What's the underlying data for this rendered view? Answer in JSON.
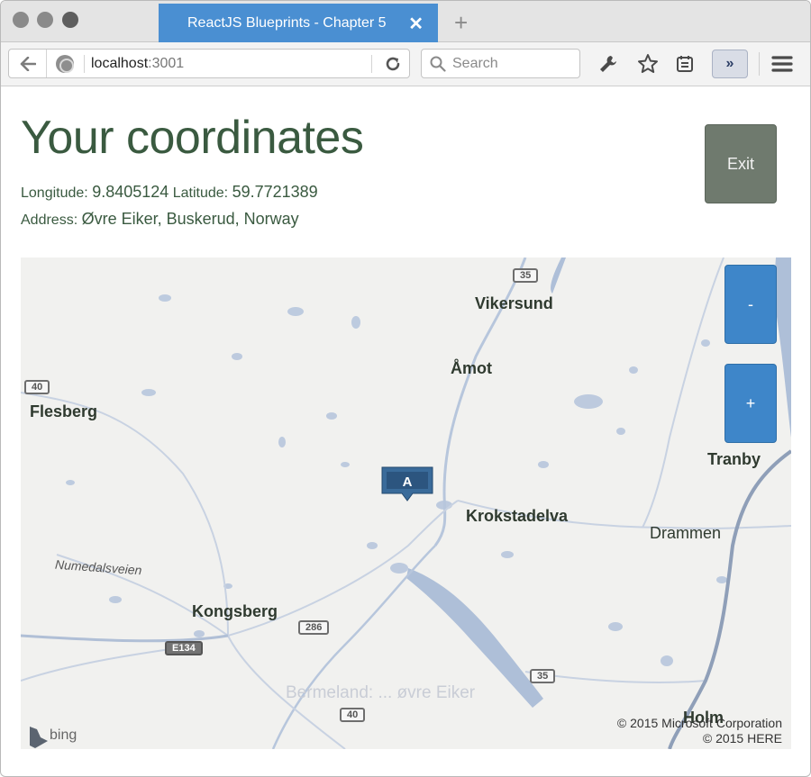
{
  "browser": {
    "tab_title": "ReactJS Blueprints - Chapter 5",
    "tab_close": "✕",
    "new_tab": "+",
    "url_host": "localhost",
    "url_port": ":3001",
    "search_placeholder": "Search",
    "overflow": "»",
    "icons": [
      "back-arrow-icon",
      "globe-icon",
      "reload-icon",
      "search-icon",
      "wrench-icon",
      "star-icon",
      "reading-list-icon",
      "menu-icon"
    ]
  },
  "page": {
    "title": "Your coordinates",
    "longitude_label": "Longitude:",
    "longitude_value": "9.8405124",
    "latitude_label": "Latitude:",
    "latitude_value": "59.7721389",
    "address_label": "Address:",
    "address_value": "Øvre Eiker, Buskerud, Norway",
    "exit_label": "Exit"
  },
  "map": {
    "zoom_out_label": "-",
    "zoom_in_label": "+",
    "marker_label": "A",
    "places": {
      "vikersund": "Vikersund",
      "amot": "Åmot",
      "flesberg": "Flesberg",
      "tranby": "Tranby",
      "krokstadelva": "Krokstadelva",
      "drammen": "Drammen",
      "kongsberg": "Kongsberg",
      "holm": "Holm",
      "road_name": "Numedalsveien",
      "faded": "Bermeland: ... øvre Eiker"
    },
    "road_shields": {
      "r35_top": "35",
      "r40_left": "40",
      "r286": "286",
      "e134": "E134",
      "r35_bottom": "35",
      "r40_bottom": "40"
    },
    "attribution": {
      "brand": "bing",
      "copyright_1": "© 2015 Microsoft Corporation",
      "copyright_2": "© 2015 HERE"
    },
    "colors": {
      "water": "#aebfd8",
      "road": "#b7c6dc",
      "major_road": "#8f9fb8",
      "zoom_button": "#3e86c9",
      "marker": "#3a6b9a"
    }
  }
}
